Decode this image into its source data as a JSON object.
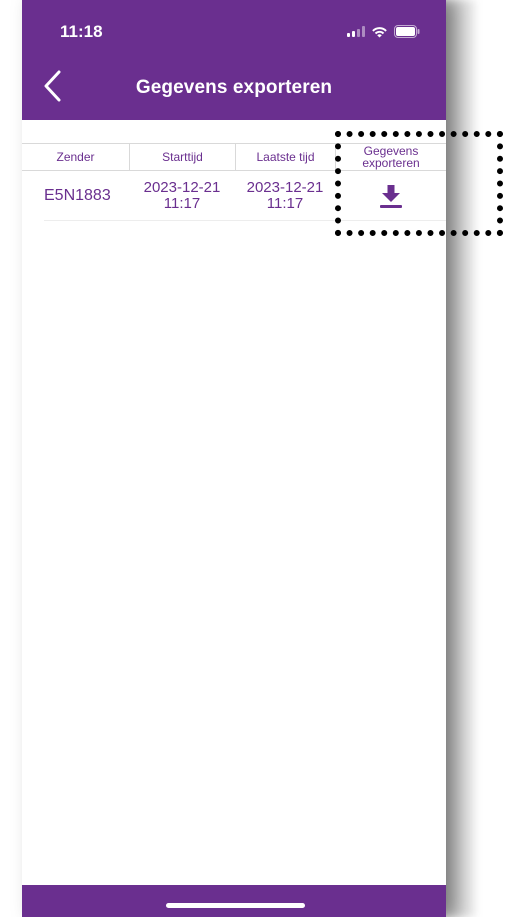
{
  "status_bar": {
    "time": "11:18",
    "icons": [
      "signal-icon",
      "wifi-icon",
      "battery-icon"
    ]
  },
  "header": {
    "title": "Gegevens exporteren",
    "back_icon": "chevron-left-icon"
  },
  "table": {
    "columns": [
      {
        "label": "Zender"
      },
      {
        "label": "Starttijd"
      },
      {
        "label": "Laatste tijd"
      },
      {
        "label_line1": "Gegevens",
        "label_line2": "exporteren"
      }
    ],
    "rows": [
      {
        "zender": "E5N1883",
        "start_date": "2023-12-21",
        "start_time": "11:17",
        "last_date": "2023-12-21",
        "last_time": "11:17",
        "export_icon": "download-icon"
      }
    ]
  },
  "colors": {
    "brand_purple": "#6a2f8f",
    "divider": "#d9d9d9",
    "background": "#ffffff"
  }
}
